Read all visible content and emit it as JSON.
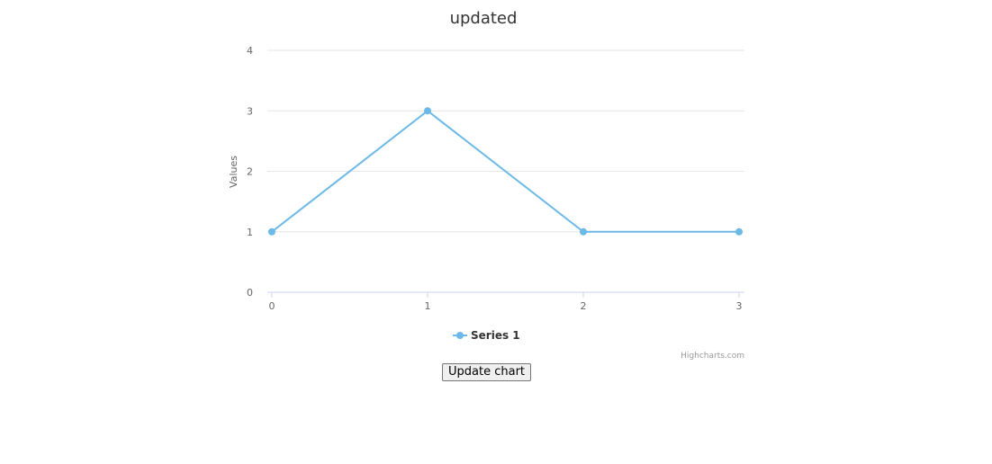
{
  "colors": {
    "series": "#6cb9e8",
    "grid": "#e6e6e6",
    "axis_line": "#ccd6eb"
  },
  "chart_data": {
    "type": "line",
    "title": "updated",
    "xlabel": "",
    "ylabel": "Values",
    "x": [
      0,
      1,
      2,
      3
    ],
    "x_tick_labels": [
      "0",
      "1",
      "2",
      "3"
    ],
    "y_tick_labels": [
      "0",
      "1",
      "2",
      "3",
      "4"
    ],
    "ylim": [
      0,
      4
    ],
    "grid": true,
    "legend_position": "bottom-center",
    "series": [
      {
        "name": "Series 1",
        "values": [
          1,
          3,
          1,
          1
        ]
      }
    ],
    "credits": "Highcharts.com"
  },
  "controls": {
    "update_button_label": "Update chart"
  }
}
